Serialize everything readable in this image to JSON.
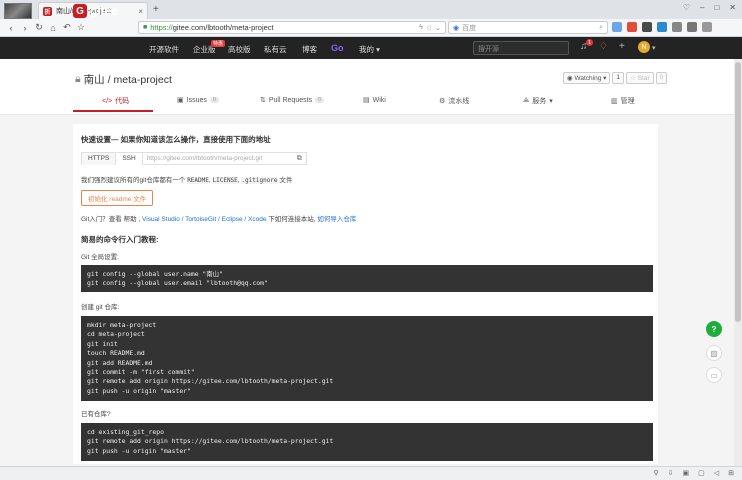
{
  "browser": {
    "tab_title": "南山/meta-project",
    "tab_favicon": "折",
    "new_tab": "+",
    "url_scheme": "https://",
    "url_rest": "gitee.com/lbtooth/meta-project",
    "search_placeholder": "百度",
    "window_controls": [
      "♡",
      "–",
      "□",
      "✕"
    ]
  },
  "gitee_nav": {
    "logo_text": "gitee",
    "items": [
      "开源软件",
      "企业版",
      "高校版",
      "私有云",
      "博客",
      "Go",
      "我的"
    ],
    "hot_badge": "特惠",
    "search_placeholder": "搜开源",
    "notification_count": "1",
    "avatar_letter": "N"
  },
  "project": {
    "owner": "南山",
    "separator": " / ",
    "name": "meta-project",
    "watch_label": "Watching",
    "watch_count": "1",
    "star_label": "Star",
    "star_count": "0",
    "tabs": [
      {
        "label": "代码",
        "icon": "</>"
      },
      {
        "label": "Issues",
        "count": "0"
      },
      {
        "label": "Pull Requests",
        "count": "0"
      },
      {
        "label": "Wiki"
      },
      {
        "label": "流水线"
      },
      {
        "label": "服务"
      },
      {
        "label": "管理"
      }
    ]
  },
  "setup": {
    "heading": "快速设置— 如果你知道该怎么操作，直接使用下面的地址",
    "protocols": [
      "HTTPS",
      "SSH"
    ],
    "repo_url": "https://gitee.com/lbtooth/meta-project.git",
    "recommend_prefix": "我们强烈建议所有的git仓库都有一个",
    "recommend_files": [
      "README",
      "LICENSE",
      ".gitignore"
    ],
    "recommend_suffix": "文件",
    "init_readme_button": "初始化 readme 文件",
    "git_intro_prefix": "Git入门？查看 帮助 , ",
    "git_intro_links": "Visual Studio / TortoiseGit / Eclipse / Xcode",
    "git_intro_mid": " 下如何连接本站, ",
    "git_intro_link2": "如何导入仓库",
    "tutorial_heading": "简易的命令行入门教程:",
    "global_label": "Git 全局设置:",
    "global_code": "git config --global user.name \"南山\"\ngit config --global user.email \"lbtooth@qq.com\"",
    "create_label": "创建 git 仓库:",
    "create_code": "mkdir meta-project\ncd meta-project\ngit init\ntouch README.md\ngit add README.md\ngit commit -m \"first commit\"\ngit remote add origin https://gitee.com/lbtooth/meta-project.git\ngit push -u origin \"master\"",
    "existing_label": "已有仓库?",
    "existing_code": "cd existing_git_repo\ngit remote add origin https://gitee.com/lbtooth/meta-project.git\ngit push -u origin \"master\""
  },
  "floating": {
    "help": "?"
  },
  "colors": {
    "brand": "#c71d23",
    "code_bg": "#333333",
    "help_green": "#1fac3d",
    "link": "#1e6fd9"
  }
}
